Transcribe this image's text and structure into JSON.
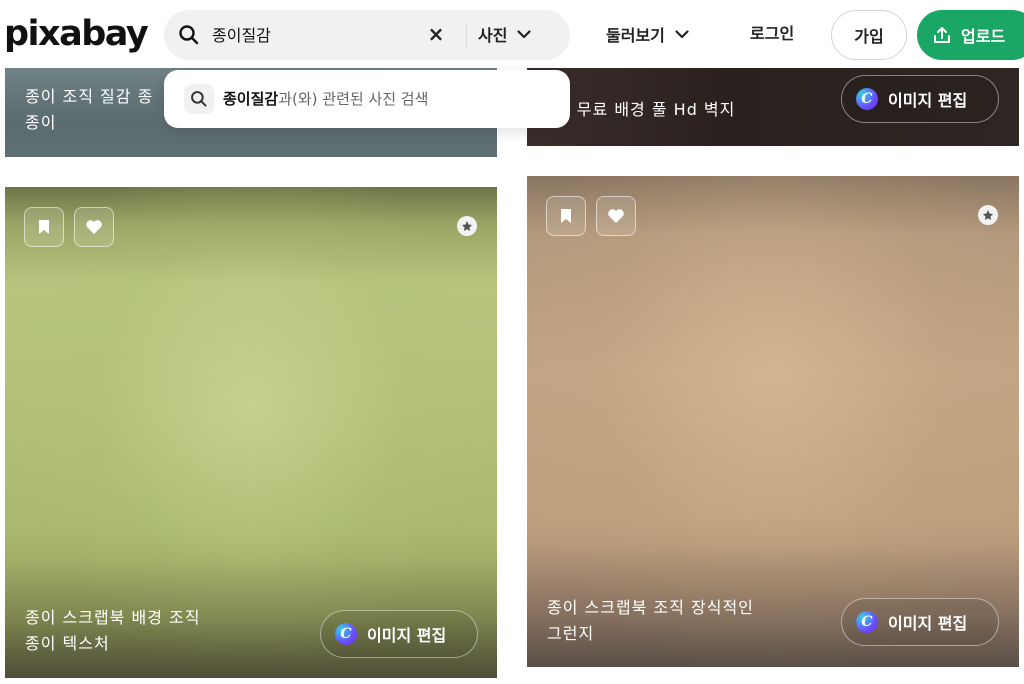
{
  "header": {
    "logo": "pixabay",
    "search": {
      "value": "종이질감",
      "placeholder": ""
    },
    "clear_symbol": "×",
    "type_select": "사진",
    "nav": {
      "explore": "둘러보기",
      "login": "로그인",
      "join": "가입",
      "upload": "업로드"
    }
  },
  "dropdown": {
    "suggestion_query": "종이질감",
    "suggestion_suffix": "과(와) 관련된 사진 검색"
  },
  "cards": {
    "top_left": {
      "caption_line1": "종이 조직 질감 종",
      "caption_line2": "종이"
    },
    "top_right": {
      "caption_line1": "음 무료 배경 풀 Hd 벽지",
      "edit_label": "이미지 편집"
    },
    "bottom_left": {
      "caption_line1": "종이 스크랩북 배경 조직",
      "caption_line2": "종이 텍스처",
      "edit_label": "이미지 편집"
    },
    "bottom_right": {
      "caption_line1": "종이 스크랩북 조직 장식적인",
      "caption_line2": "그런지",
      "edit_label": "이미지 편집"
    }
  },
  "colors": {
    "brand_green": "#1aa664",
    "search_bg": "#f1f1f1"
  },
  "icons": [
    "search-icon",
    "close-icon",
    "chevron-down-icon",
    "upload-icon",
    "bookmark-icon",
    "heart-icon",
    "premium-icon",
    "canva-icon"
  ]
}
